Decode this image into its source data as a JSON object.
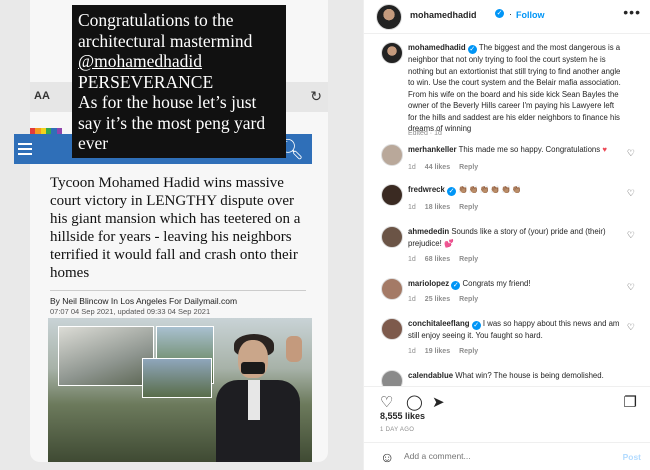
{
  "media": {
    "overlay_lines": [
      "Congratulations to the",
      "architectural mastermind",
      "@mohamedhadid",
      "PERSEVERANCE",
      "As for the house let’s just",
      "say it’s the most peng yard",
      "ever"
    ],
    "browser_aa": "AA",
    "headline": "Tycoon Mohamed Hadid wins massive court victory in LENGTHY dispute over his giant mansion which has teetered on a hillside for years - leaving his neighbors terrified it would fall and crash onto their homes",
    "byline": "By Neil Blincow In Los Angeles For Dailymail.com",
    "dateline": "07:07 04 Sep 2021, updated 09:33 04 Sep 2021"
  },
  "panel": {
    "username": "mohamedhadid",
    "follow_label": "Follow",
    "more_label": "•••",
    "caption": {
      "user": "mohamedhadid",
      "text": "The biggest and the most dangerous is a neighbor that not only trying to fool the court system he is nothing but an extortionist that still trying to find another angle to win. Use the court system and the Belair mafia association. From his wife on the board and his side kick Sean Bayles the owner of the Beverly Hills career I'm paying his Lawyere left for the hills and saddest are his elder neighbors to finance his dreams of winning",
      "meta": "Edited · 1d"
    },
    "comments": [
      {
        "user": "merhankeller",
        "text": "This made me so happy. Congratulations",
        "emoji": "♥",
        "age": "1d",
        "likes": "44 likes",
        "reply": "Reply",
        "avatar_color": "#b9a89a"
      },
      {
        "user": "fredwreck",
        "text": "",
        "emoji": "👏🏽👏🏽👏🏽👏🏽👏🏽👏🏽",
        "age": "1d",
        "likes": "18 likes",
        "reply": "Reply",
        "avatar_color": "#3a2a22"
      },
      {
        "user": "ahmededin",
        "text": "Sounds like a story of (your) pride and (their) prejudice!",
        "emoji": "💕",
        "age": "1d",
        "likes": "68 likes",
        "reply": "Reply",
        "avatar_color": "#6b5446"
      },
      {
        "user": "mariolopez",
        "text": "Congrats my friend!",
        "emoji": "",
        "age": "1d",
        "likes": "25 likes",
        "reply": "Reply",
        "avatar_color": "#a47a66"
      },
      {
        "user": "conchitaleeflang",
        "text": "I was so happy about this news and am still enjoy seeing it. You faught so hard.",
        "emoji": "",
        "age": "1d",
        "likes": "19 likes",
        "reply": "Reply",
        "avatar_color": "#7d5a4c"
      },
      {
        "user": "calendablue",
        "text": "What win? The house is being demolished.",
        "emoji": "",
        "age": "",
        "likes": "",
        "reply": "",
        "avatar_color": "#8a8a8a"
      }
    ],
    "likes": "8,555 likes",
    "ago": "1 DAY AGO",
    "comment_placeholder": "Add a comment...",
    "post_label": "Post"
  }
}
